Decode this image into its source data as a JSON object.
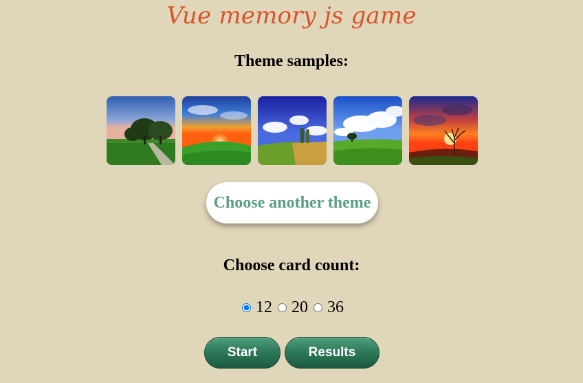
{
  "header": {
    "title": "Vue memory js game"
  },
  "theme": {
    "samples_heading": "Theme samples:",
    "thumbnails": [
      {
        "icon": "landscape-tree-road-image"
      },
      {
        "icon": "landscape-sunset-hill-image"
      },
      {
        "icon": "landscape-blue-sky-field-image"
      },
      {
        "icon": "landscape-clouds-grass-image"
      },
      {
        "icon": "landscape-sunset-dead-tree-image"
      }
    ],
    "choose_button_label": "Choose another theme"
  },
  "cards": {
    "heading": "Choose card count:",
    "options": [
      "12",
      "20",
      "36"
    ],
    "selected": "12"
  },
  "actions": {
    "start_label": "Start",
    "results_label": "Results"
  },
  "colors": {
    "background": "#e0d6b9",
    "title": "#d9542a",
    "theme_button_text": "#5b9e85",
    "action_button": "#2f7a5a"
  }
}
